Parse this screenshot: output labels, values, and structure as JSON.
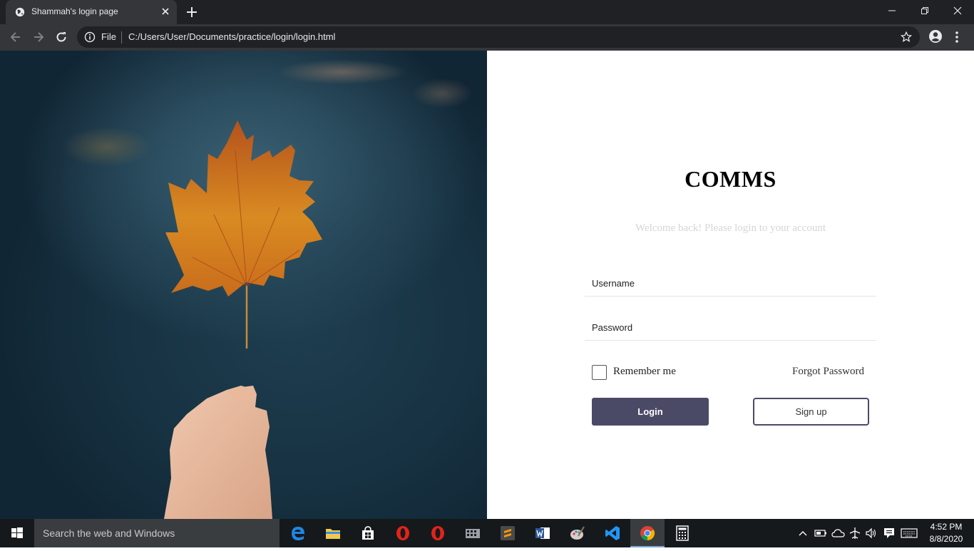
{
  "browser": {
    "tab_title": "Shammah's login page",
    "scheme_label": "File",
    "url": "C:/Users/User/Documents/practice/login/login.html"
  },
  "page": {
    "brand": "COMMS",
    "welcome": "Welcome back! Please login to your account",
    "username_placeholder": "Username",
    "password_placeholder": "Password",
    "remember_label": "Remember me",
    "remember_checked": false,
    "forgot_label": "Forgot Password",
    "login_label": "Login",
    "signup_label": "Sign up",
    "accent_color": "#4b4a66"
  },
  "taskbar": {
    "search_placeholder": "Search the web and Windows",
    "apps": [
      "edge",
      "file-explorer",
      "store",
      "opera",
      "opera",
      "media-app",
      "sublime-text",
      "word",
      "paint",
      "vscode",
      "chrome",
      "calculator"
    ],
    "active_app": "chrome",
    "clock_time": "4:52 PM",
    "clock_date": "8/8/2020"
  }
}
